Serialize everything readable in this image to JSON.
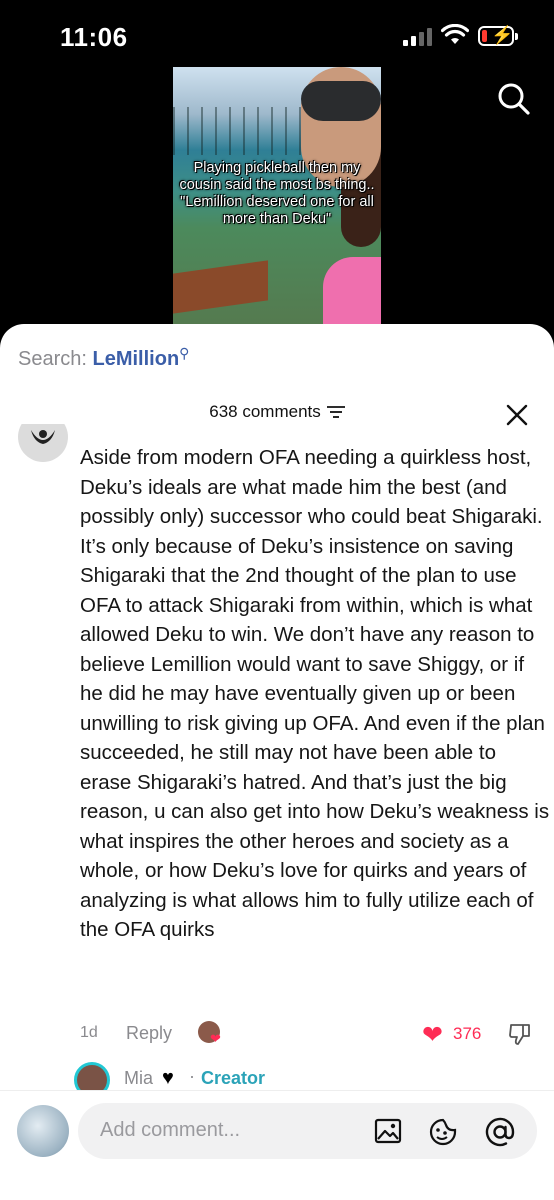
{
  "status_bar": {
    "time": "11:06"
  },
  "video": {
    "caption": "Playing pickleball then my cousin said the most bs thing.. \"Lemillion deserved one for all more than Deku\""
  },
  "search": {
    "label": "Search:",
    "term": "LeMillion"
  },
  "comments": {
    "count": "638 comments",
    "comment": {
      "text": "Aside from modern OFA needing a quirkless host, Deku’s ideals are what made him the best (and possibly only) successor who could beat Shigaraki. It’s only because of Deku’s insistence on saving Shigaraki that the 2nd thought of the plan to use OFA to attack Shigaraki from within, which is what allowed Deku to win. We don’t have any reason to believe Lemillion would want to save Shiggy, or if he did he may have eventually given up or been unwilling to risk giving up OFA. And even if the plan succeeded, he still may not have been able to erase Shigaraki’s hatred. And that’s just the big reason, u can also get into how Deku’s weakness is what inspires the other heroes and society as a whole, or how Deku’s love for quirks and years of analyzing is what allows him to fully utilize each of the OFA quirks",
      "age": "1d",
      "reply_label": "Reply",
      "likes": "376"
    },
    "reply_preview": {
      "name": "Mia",
      "badge": "Creator"
    }
  },
  "composer": {
    "placeholder": "Add comment..."
  },
  "colors": {
    "accent_red": "#fe2c55",
    "search_blue": "#3b5ea8",
    "creator_teal": "#2ba3b8"
  }
}
